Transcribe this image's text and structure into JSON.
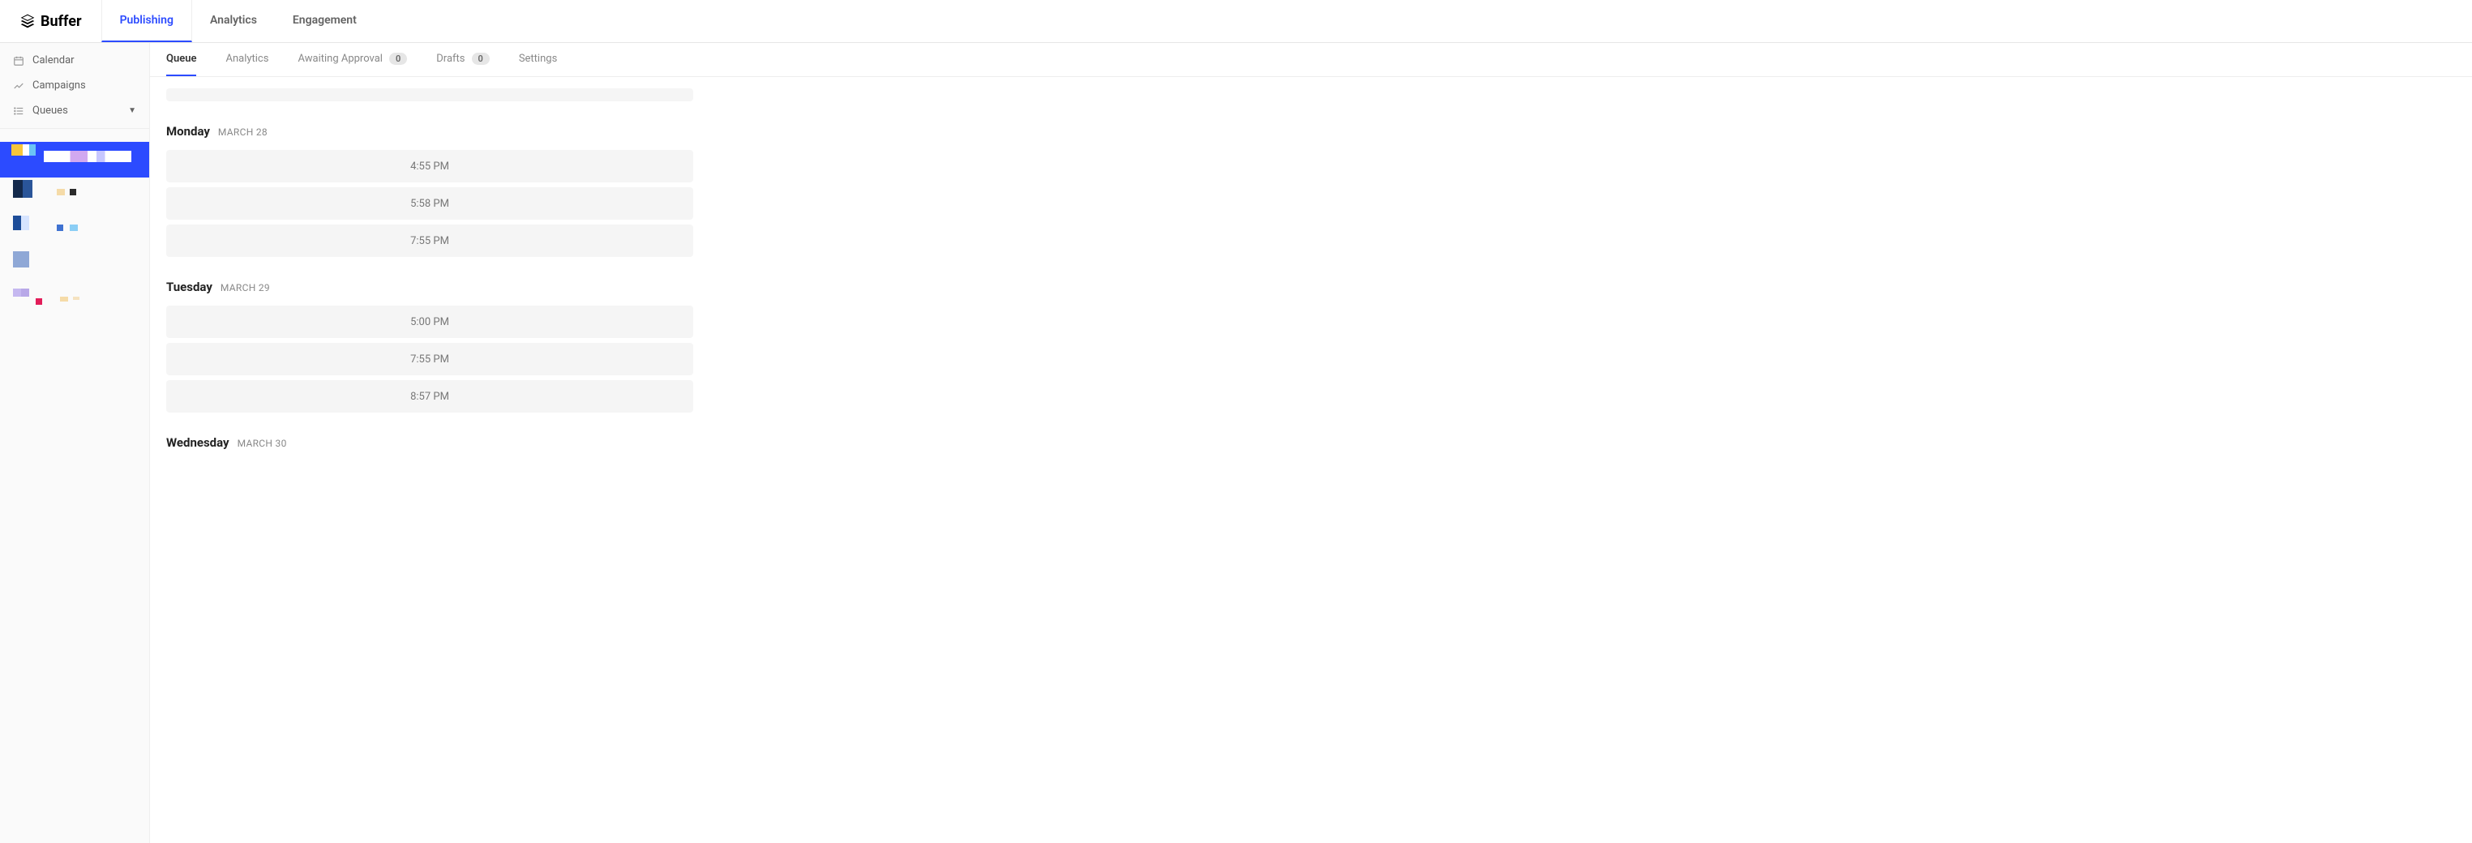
{
  "brand": {
    "name": "Buffer"
  },
  "top_nav": {
    "tabs": [
      {
        "label": "Publishing",
        "active": true
      },
      {
        "label": "Analytics",
        "active": false
      },
      {
        "label": "Engagement",
        "active": false
      }
    ]
  },
  "sidebar": {
    "items": [
      {
        "icon": "calendar-icon",
        "label": "Calendar"
      },
      {
        "icon": "trend-icon",
        "label": "Campaigns"
      },
      {
        "icon": "list-icon",
        "label": "Queues",
        "has_chevron": true
      }
    ]
  },
  "sub_tabs": {
    "items": [
      {
        "label": "Queue",
        "active": true
      },
      {
        "label": "Analytics"
      },
      {
        "label": "Awaiting Approval",
        "badge": "0"
      },
      {
        "label": "Drafts",
        "badge": "0"
      },
      {
        "label": "Settings"
      }
    ]
  },
  "queue": {
    "days": [
      {
        "name": "Monday",
        "date": "MARCH 28",
        "slots": [
          "4:55 PM",
          "5:58 PM",
          "7:55 PM"
        ]
      },
      {
        "name": "Tuesday",
        "date": "MARCH 29",
        "slots": [
          "5:00 PM",
          "7:55 PM",
          "8:57 PM"
        ]
      },
      {
        "name": "Wednesday",
        "date": "MARCH 30",
        "slots": []
      }
    ]
  }
}
